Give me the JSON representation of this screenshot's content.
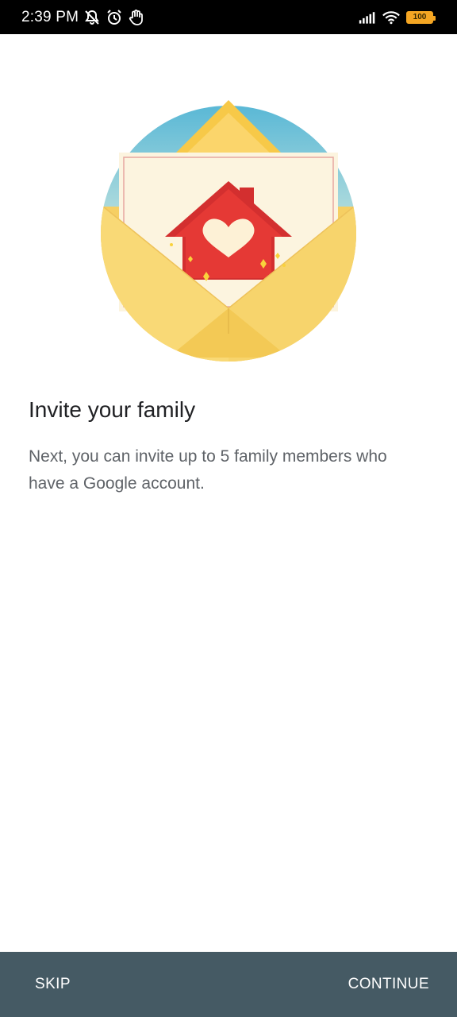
{
  "status_bar": {
    "time": "2:39 PM",
    "icons_left": [
      "notifications-off-icon",
      "alarm-icon",
      "hand-icon"
    ],
    "icons_right": [
      "signal-icon",
      "wifi-icon",
      "battery-icon"
    ],
    "battery_level": "100",
    "colors": {
      "background": "#000000",
      "battery": "#f5a623"
    }
  },
  "main": {
    "illustration": "invite-family-envelope-illustration",
    "title": "Invite your family",
    "description": "Next, you can invite up to 5 family members who have a Google account."
  },
  "bottom_bar": {
    "skip_label": "SKIP",
    "continue_label": "CONTINUE",
    "background_color": "#455a64"
  }
}
